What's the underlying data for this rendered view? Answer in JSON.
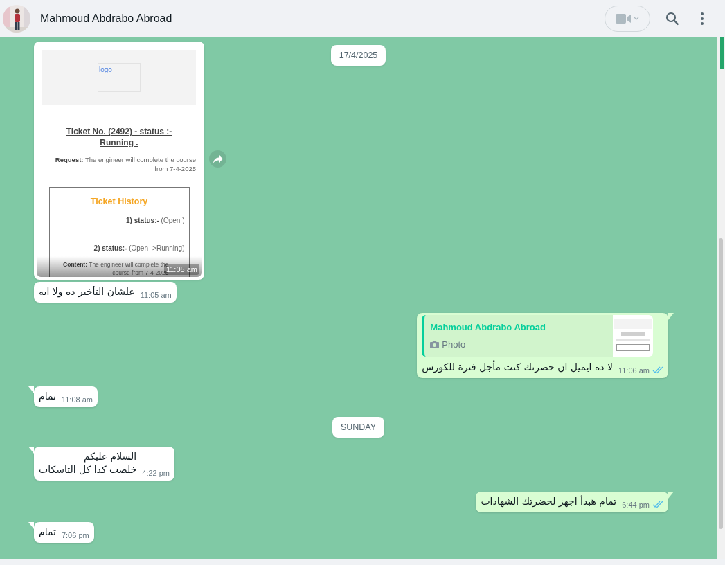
{
  "header": {
    "contact_name": "Mahmoud Abdrabo Abroad"
  },
  "messages": [
    {
      "kind": "date",
      "text": "17/4/2025"
    },
    {
      "outgoing": false,
      "tail": false,
      "time": "11:05 am",
      "email": {
        "logo": "logo",
        "title": "Ticket No. (2492) - status :- Running .",
        "request_label": "Request:",
        "request_text": "The engineer will complete the course from 7-4-2025",
        "history_title": "Ticket History",
        "history": [
          {
            "label": "1) status:-",
            "value": "(Open )"
          },
          {
            "label": "2) status:-",
            "value": "(Open ->Running)"
          }
        ],
        "content_label": "Content:",
        "content_text": "The engineer will complete the course from 7-4-2025"
      }
    },
    {
      "kind": "text",
      "outgoing": false,
      "tail": false,
      "lines": [
        "علشان التأخير ده ولا ايه"
      ],
      "time": "11:05 am"
    },
    {
      "kind": "text",
      "outgoing": true,
      "tail": true,
      "quote": {
        "sender": "Mahmoud Abdrabo Abroad",
        "label": "Photo"
      },
      "lines": [
        "لا ده ايميل ان حضرتك كنت مأجل فترة للكورس"
      ],
      "time": "11:06 am",
      "read": true
    },
    {
      "kind": "text",
      "outgoing": false,
      "tail": true,
      "lines": [
        "تمام"
      ],
      "time": "11:08 am"
    },
    {
      "kind": "date",
      "text": "SUNDAY"
    },
    {
      "kind": "text",
      "outgoing": false,
      "tail": true,
      "lines": [
        "السلام عليكم",
        "خلصت كدا كل التاسكات"
      ],
      "time": "4:22 pm"
    },
    {
      "kind": "text",
      "outgoing": true,
      "tail": true,
      "lines": [
        "تمام هبدأ اجهز لحضرتك الشهادات"
      ],
      "time": "6:44 pm",
      "read": true
    },
    {
      "kind": "text",
      "outgoing": false,
      "tail": true,
      "lines": [
        "تمام"
      ],
      "time": "7:06 pm"
    }
  ]
}
